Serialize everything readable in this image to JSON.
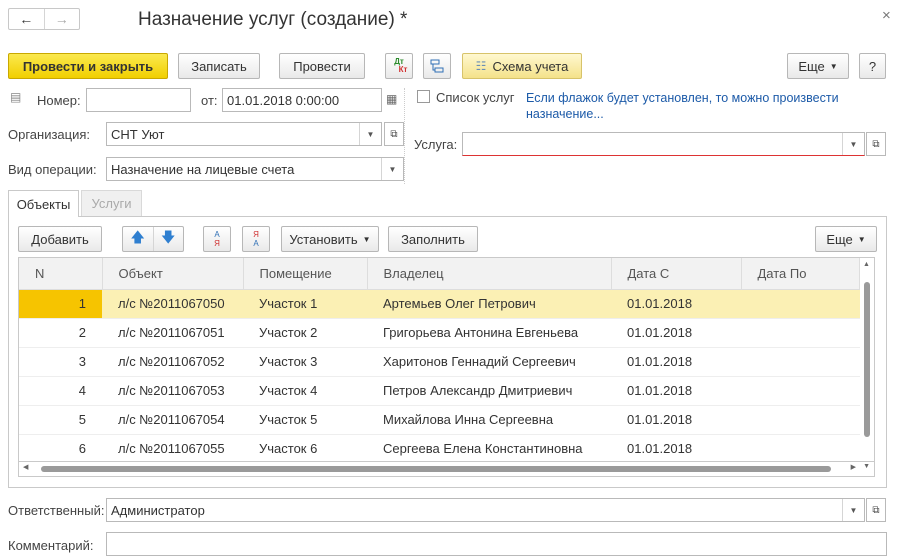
{
  "window": {
    "title": "Назначение услуг (создание) *"
  },
  "toolbar": {
    "post_close": "Провести и закрыть",
    "save": "Записать",
    "post": "Провести",
    "dtkt_top": "Дт",
    "dtkt_bot": "Кт",
    "scheme": "Схема учета",
    "more": "Еще",
    "help": "?"
  },
  "form": {
    "number_label": "Номер:",
    "number_value": "",
    "from_label": "от:",
    "date_value": "01.01.2018  0:00:00",
    "org_label": "Организация:",
    "org_value": "СНТ Уют",
    "optype_label": "Вид операции:",
    "optype_value": "Назначение на лицевые счета",
    "services_list_label": "Список услуг",
    "services_list_checked": false,
    "hint": "Если флажок будет установлен, то можно произвести назначение...",
    "service_label": "Услуга:",
    "service_value": ""
  },
  "tabs": [
    {
      "label": "Объекты"
    },
    {
      "label": "Услуги"
    }
  ],
  "table_toolbar": {
    "add": "Добавить",
    "sort_asc_top": "А",
    "sort_asc_bot": "Я",
    "sort_desc_top": "Я",
    "sort_desc_bot": "А",
    "set": "Установить",
    "fill": "Заполнить",
    "more": "Еще"
  },
  "table": {
    "columns": [
      "N",
      "Объект",
      "Помещение",
      "Владелец",
      "Дата С",
      "Дата По"
    ],
    "rows": [
      [
        "1",
        "л/с №2011067050",
        "Участок 1",
        "Артемьев Олег Петрович",
        "01.01.2018",
        ""
      ],
      [
        "2",
        "л/с №2011067051",
        "Участок 2",
        "Григорьева Антонина Евгеньева",
        "01.01.2018",
        ""
      ],
      [
        "3",
        "л/с №2011067052",
        "Участок 3",
        "Харитонов Геннадий Сергеевич",
        "01.01.2018",
        ""
      ],
      [
        "4",
        "л/с №2011067053",
        "Участок 4",
        "Петров Александр Дмитриевич",
        "01.01.2018",
        ""
      ],
      [
        "5",
        "л/с №2011067054",
        "Участок 5",
        "Михайлова Инна Сергеевна",
        "01.01.2018",
        ""
      ],
      [
        "6",
        "л/с №2011067055",
        "Участок 6",
        "Сергеева Елена Константиновна",
        "01.01.2018",
        ""
      ]
    ],
    "selected_row": 0
  },
  "footer": {
    "responsible_label": "Ответственный:",
    "responsible_value": "Администратор",
    "comment_label": "Комментарий:",
    "comment_value": ""
  },
  "colors": {
    "accent": "#f6c400",
    "link": "#1c5aa8",
    "selected_row": "#fbf0b4"
  }
}
